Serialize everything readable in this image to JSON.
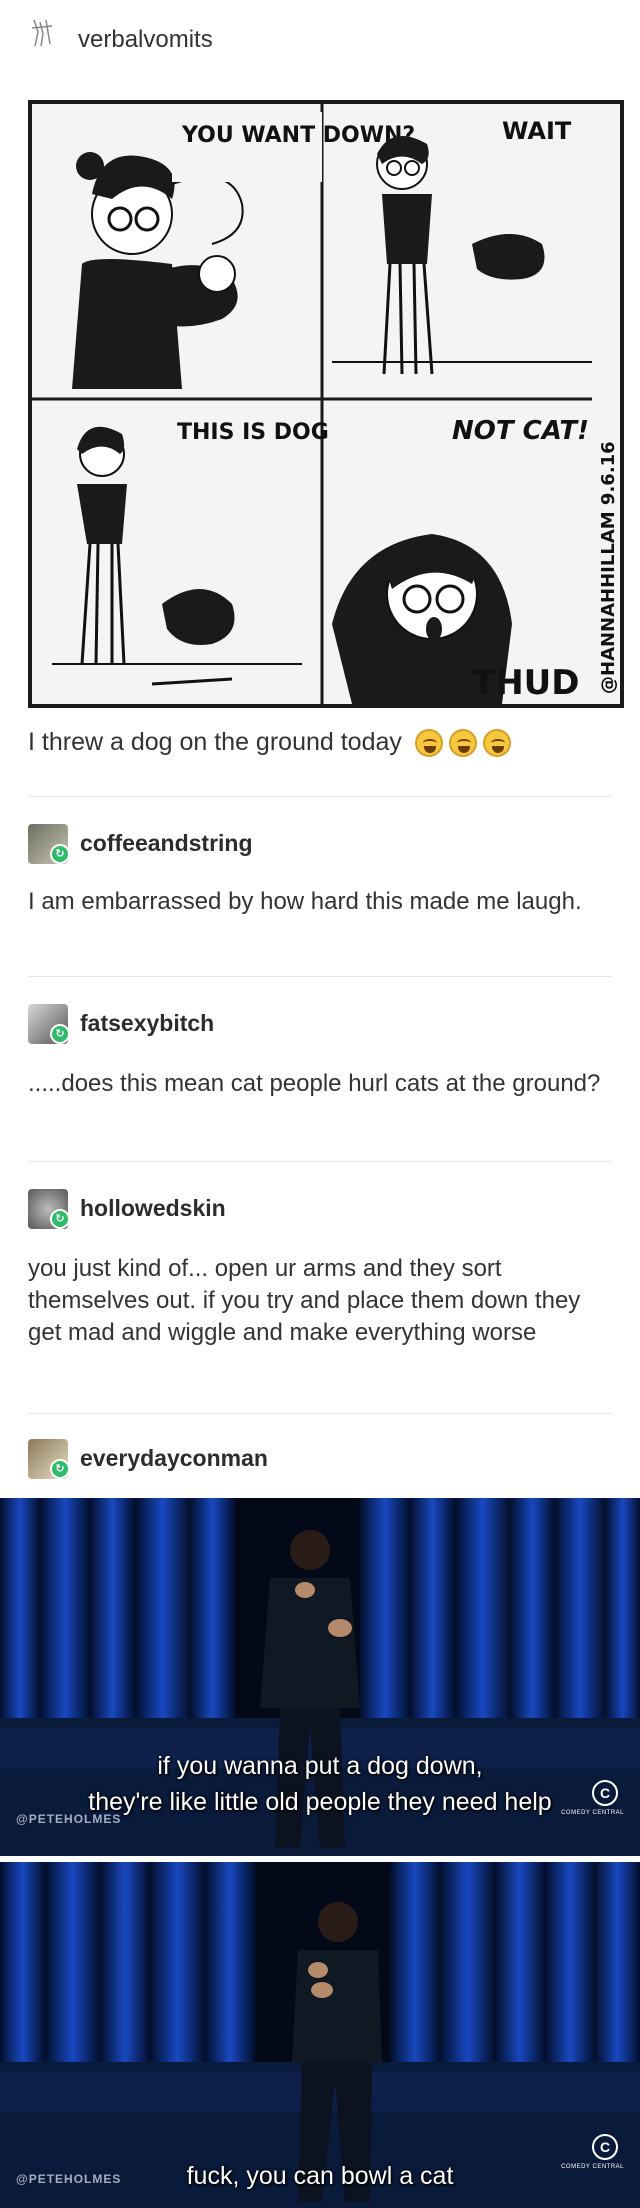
{
  "op": {
    "username": "verbalvomits",
    "avatar_icon": "scribble-avatar-icon"
  },
  "comic": {
    "panels": [
      {
        "speech": "YOU WANT DOWN?"
      },
      {
        "speech": "WAIT"
      },
      {
        "speech": "THIS IS DOG"
      },
      {
        "speech": "NOT CAT!",
        "sfx": "THUD"
      }
    ],
    "signature": "@HANNAHHILLAM 9.6.16"
  },
  "caption": {
    "text": "I threw a dog on the ground today",
    "emoji": [
      "tears-of-joy-emoji",
      "tears-of-joy-emoji",
      "tears-of-joy-emoji"
    ]
  },
  "reblogs": [
    {
      "username": "coffeeandstring",
      "text": "I am embarrassed by how hard this made me laugh."
    },
    {
      "username": "fatsexybitch",
      "text": ".....does this mean cat people hurl cats at the ground?"
    },
    {
      "username": "hollowedskin",
      "text": "you just kind of... open ur arms and they sort themselves out. if you try and place them down they get mad and wiggle and make everything worse"
    },
    {
      "username": "everydayconman",
      "text": ""
    }
  ],
  "videos": [
    {
      "subtitle_line1": "if you wanna put a dog down,",
      "subtitle_line2": "they're like little old people they need help",
      "watermark": "@PETEHOLMES",
      "network": "COMEDY CENTRAL"
    },
    {
      "subtitle_line1": "fuck, you can bowl a cat",
      "watermark": "@PETEHOLMES",
      "network": "COMEDY CENTRAL"
    }
  ],
  "colors": {
    "reblog_badge": "#2fbc6a",
    "stage_blue": "#0c2f8a",
    "text": "#333333"
  }
}
